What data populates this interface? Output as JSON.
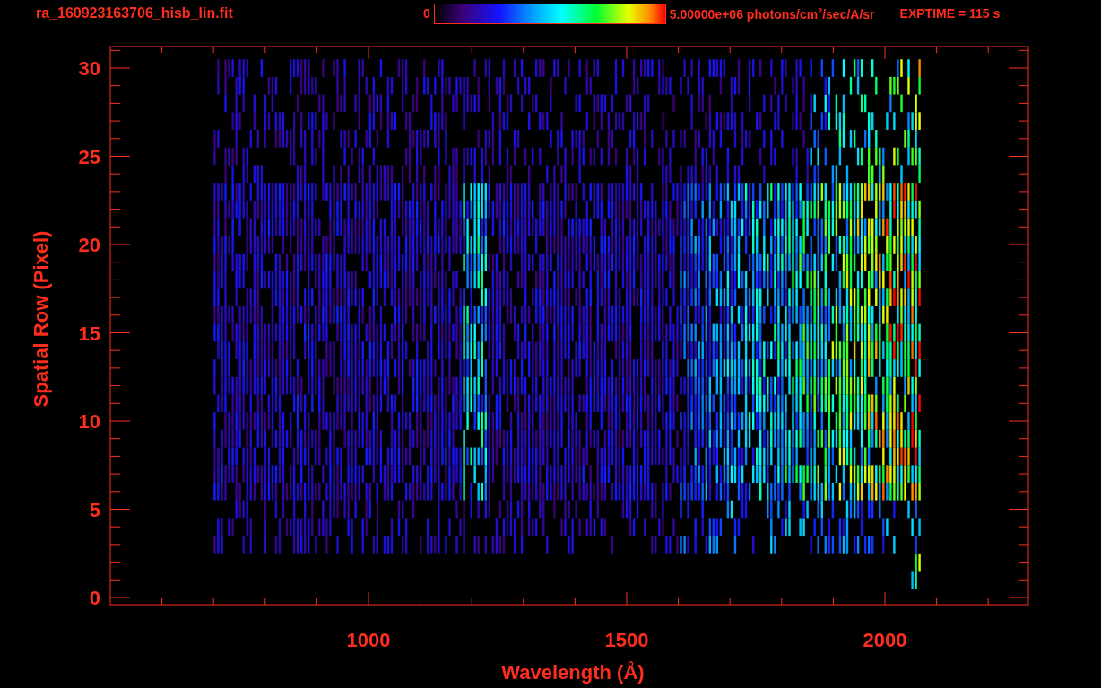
{
  "header": {
    "file_name": "ra_160923163706_hisb_lin.fit",
    "colorbar": {
      "min_label": "0",
      "max_label": "5.00000e+06 photons/cm$^{2}$/sec/A/sr"
    },
    "exposure": "EXPTIME = 115 s"
  },
  "plot": {
    "x_axis": {
      "title": "Wavelength (Å)",
      "ticks": [
        "1000",
        "1500",
        "2000"
      ]
    },
    "y_axis": {
      "title": "Spatial Row (Pixel)",
      "ticks": [
        "30",
        "25",
        "20",
        "15",
        "10",
        "5",
        "0"
      ]
    }
  }
}
